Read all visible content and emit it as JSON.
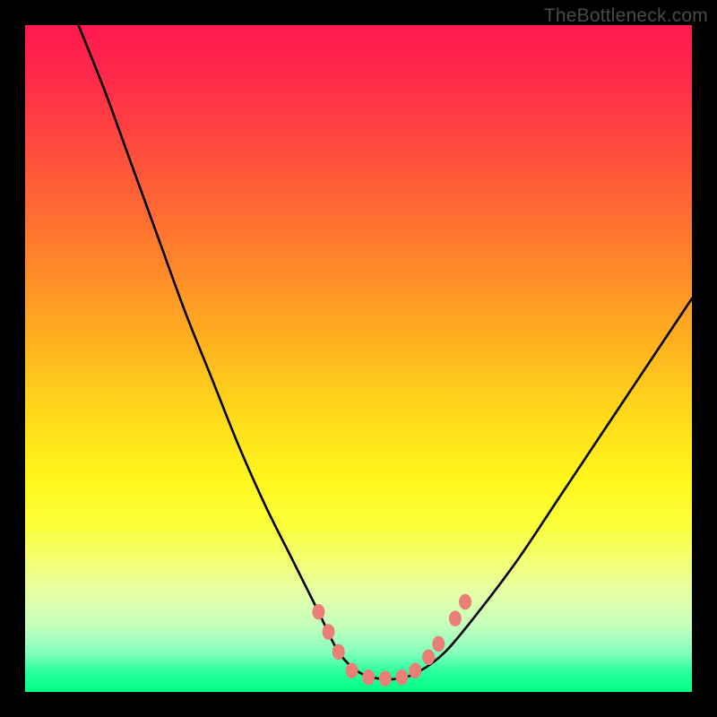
{
  "watermark": "TheBottleneck.com",
  "chart_data": {
    "type": "line",
    "title": "",
    "xlabel": "",
    "ylabel": "",
    "xlim": [
      0,
      100
    ],
    "ylim": [
      0,
      100
    ],
    "note": "Vertical gradient background red (top, 100%) to green (bottom, 0%). Curve is a V-shaped bottleneck trace with minimum (optimal) region near x≈48–58, y≈2. Markers are pink beads on the near-bottom flanks of the V, visually indicating the sweet-spot band.",
    "series": [
      {
        "name": "bottleneck-curve",
        "color": "#000000",
        "x": [
          8,
          12,
          16,
          20,
          24,
          28,
          32,
          36,
          40,
          44,
          47,
          50,
          53,
          56,
          59,
          63,
          68,
          74,
          80,
          86,
          92,
          98,
          100
        ],
        "y": [
          100,
          90,
          79,
          68,
          57,
          47,
          37,
          28,
          20,
          12,
          6,
          3,
          2,
          2,
          3,
          6,
          12,
          20,
          29,
          38,
          47,
          56,
          59
        ]
      }
    ],
    "markers": {
      "color": "#e97f77",
      "radius_px": 7,
      "points": [
        {
          "x": 44.0,
          "y": 12.0
        },
        {
          "x": 45.5,
          "y": 9.0
        },
        {
          "x": 47.0,
          "y": 6.0
        },
        {
          "x": 49.0,
          "y": 3.2
        },
        {
          "x": 51.5,
          "y": 2.2
        },
        {
          "x": 54.0,
          "y": 2.0
        },
        {
          "x": 56.5,
          "y": 2.2
        },
        {
          "x": 58.5,
          "y": 3.2
        },
        {
          "x": 60.5,
          "y": 5.2
        },
        {
          "x": 62.0,
          "y": 7.2
        },
        {
          "x": 64.5,
          "y": 11.0
        },
        {
          "x": 66.0,
          "y": 13.5
        }
      ]
    }
  }
}
